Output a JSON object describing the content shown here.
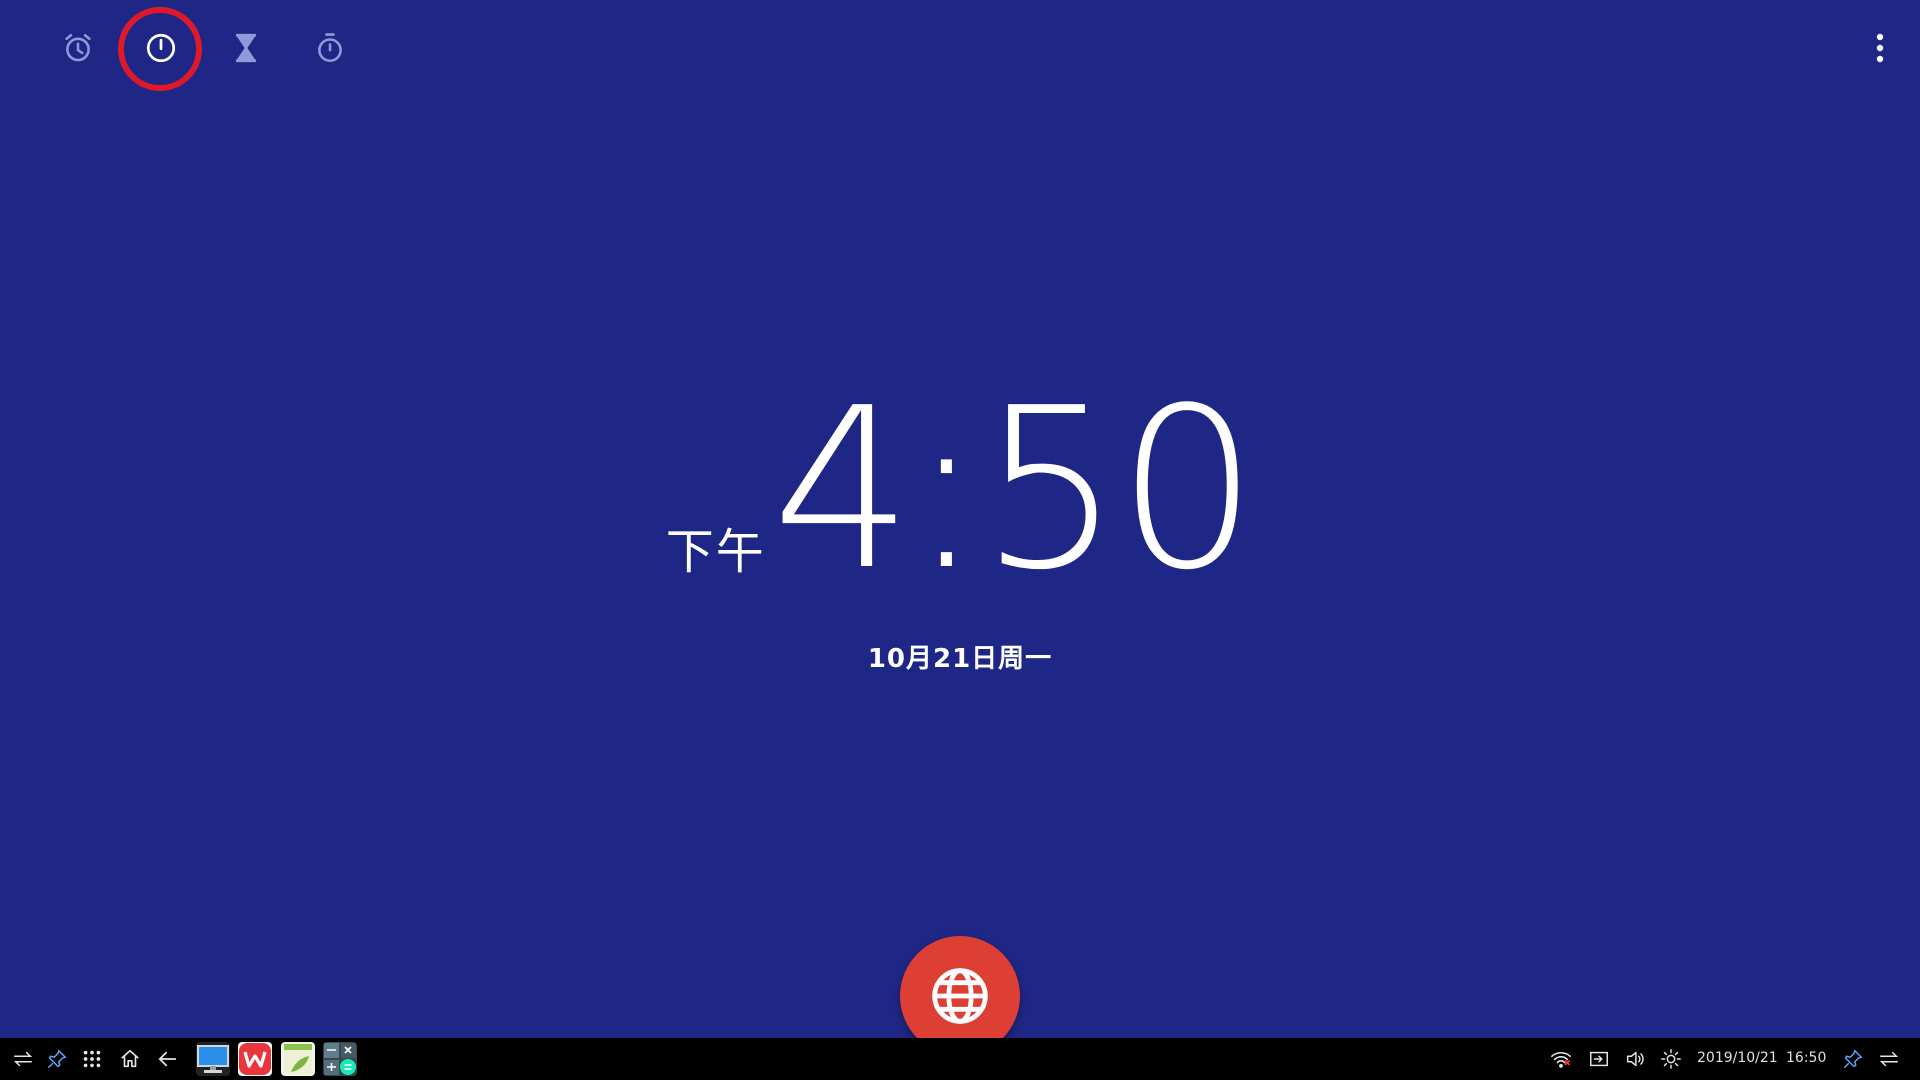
{
  "tabs": [
    {
      "name": "alarm",
      "icon": "alarm-icon",
      "active": false
    },
    {
      "name": "clock",
      "icon": "clock-icon",
      "active": true
    },
    {
      "name": "timer",
      "icon": "hourglass-icon",
      "active": false
    },
    {
      "name": "stopwatch",
      "icon": "stopwatch-icon",
      "active": false
    }
  ],
  "clock": {
    "ampm": "下午",
    "time": "4:50",
    "date": "10月21日周一"
  },
  "fab": {
    "icon": "globe-icon"
  },
  "taskbar": {
    "date": "2019/10/21",
    "time": "16:50",
    "apps": [
      "desktop-app-icon",
      "wps-office-icon",
      "notes-app-icon",
      "calculator-app-icon"
    ]
  },
  "colors": {
    "background": "#1f2786",
    "highlight": "#e0192a",
    "fab": "#de3f35",
    "taskbar": "#000000"
  }
}
